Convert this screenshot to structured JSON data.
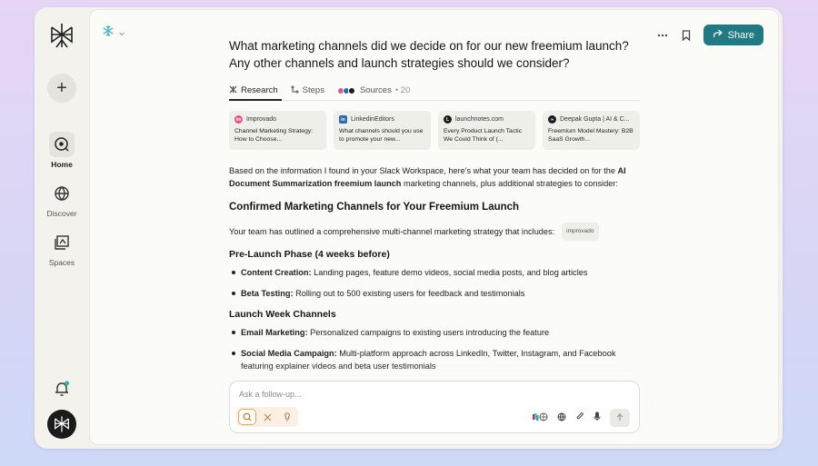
{
  "sidebar": {
    "new_label": "+",
    "items": [
      {
        "label": "Home",
        "icon": "search-circle-icon",
        "active": true
      },
      {
        "label": "Discover",
        "icon": "globe-icon",
        "active": false
      },
      {
        "label": "Spaces",
        "icon": "spaces-icon",
        "active": false
      }
    ]
  },
  "header": {
    "share_label": "Share"
  },
  "thread": {
    "question": "What marketing channels did we decide on for our new freemium launch? Any other channels and launch strategies should we consider?",
    "tabs": {
      "research": "Research",
      "steps": "Steps",
      "sources": "Sources",
      "sources_count": "• 20"
    },
    "source_cards": [
      {
        "site": "Improvado",
        "title": "Channel Marketing Strategy: How to Choose...",
        "color": "#e4518a",
        "glyph": "im"
      },
      {
        "site": "LinkedinEditors",
        "title": "What channels should you use to promote your new...",
        "color": "#2b6cb0",
        "glyph": "in"
      },
      {
        "site": "launchnotes.com",
        "title": "Every Product Launch Tactic We Could Think of (...",
        "color": "#1b1b1b",
        "glyph": "L"
      },
      {
        "site": "Deepak Gupta | AI & C...",
        "title": "Freemium Model Mastery: B2B SaaS Growth...",
        "color": "#1b1b1b",
        "glyph": "∞"
      }
    ]
  },
  "answer": {
    "intro_1": "Based on the information I found in your Slack Workspace, here's what your team has decided on for the",
    "intro_bold": "AI Document Summarization freemium launch",
    "intro_2": "marketing channels, plus additional strategies to consider:",
    "heading_confirmed": "Confirmed Marketing Channels for Your Freemium Launch",
    "outline_text": "Your team has outlined a comprehensive multi-channel marketing strategy that includes:",
    "outline_badge": "improvado",
    "phase_heading": "Pre-Launch Phase (4 weeks before)",
    "prelaunch": [
      {
        "term": "Content Creation:",
        "text": "Landing pages, feature demo videos, social media posts, and blog articles"
      },
      {
        "term": "Beta Testing:",
        "text": "Rolling out to 500 existing users for feedback and testimonials"
      }
    ],
    "launch_heading": "Launch Week Channels",
    "launch": [
      {
        "term": "Email Marketing:",
        "text": "Personalized campaigns to existing users introducing the feature"
      },
      {
        "term": "Social Media Campaign:",
        "text": "Multi-platform approach across LinkedIn, Twitter, Instagram, and Facebook featuring explainer videos and beta user testimonials"
      }
    ]
  },
  "composer": {
    "placeholder": "Ask a follow-up..."
  },
  "colors": {
    "accent": "#1f7a83",
    "mode_active_border": "#e3a95a",
    "space_icon": "#4fb6c7"
  }
}
